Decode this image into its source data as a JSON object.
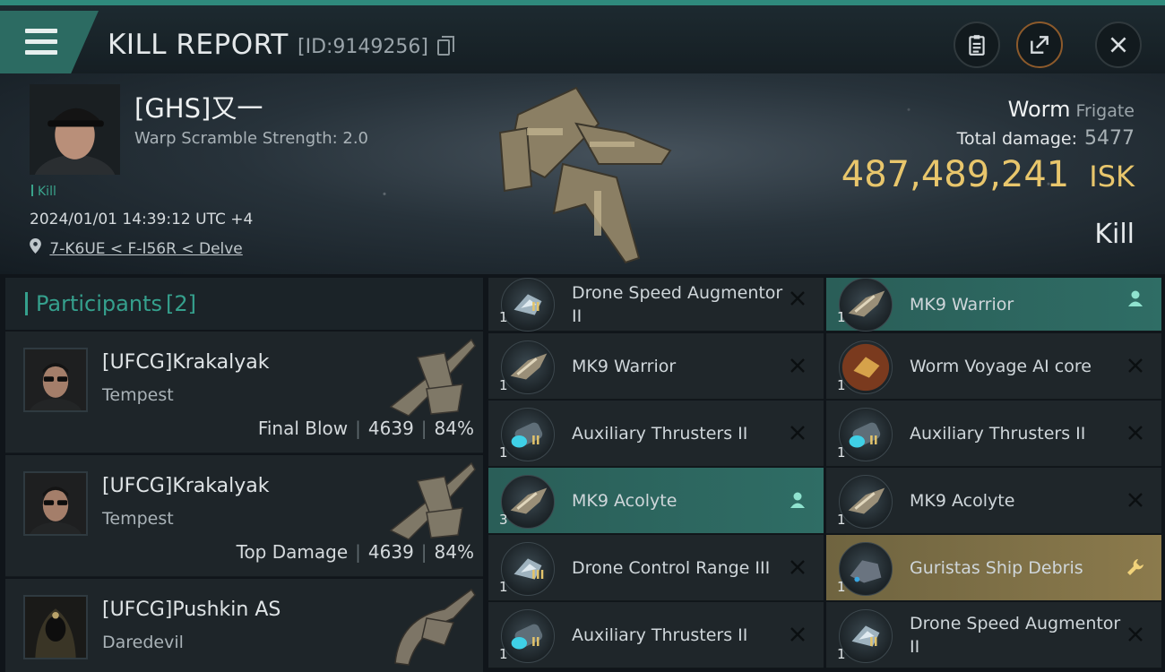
{
  "window": {
    "title": "KILL REPORT",
    "id_text": "[ID:9149256]"
  },
  "victim": {
    "name": "[GHS]又一",
    "stat": "Warp Scramble Strength: 2.0",
    "tag": "Kill",
    "datetime": "2024/01/01 14:39:12 UTC +4",
    "location": "7-K6UE < F-I56R < Delve",
    "ship_name": "Worm",
    "ship_class": "Frigate",
    "total_damage_label": "Total damage:",
    "total_damage": "5477",
    "isk_value": "487,489,241",
    "isk_unit": "ISK",
    "result": "Kill"
  },
  "participants": {
    "label": "Participants",
    "count": "[2]",
    "items": [
      {
        "name": "[UFCG]Krakalyak",
        "ship": "Tempest",
        "role": "Final Blow",
        "damage": "4639",
        "percent": "84%"
      },
      {
        "name": "[UFCG]Krakalyak",
        "ship": "Tempest",
        "role": "Top Damage",
        "damage": "4639",
        "percent": "84%"
      },
      {
        "name": "[UFCG]Pushkin AS",
        "ship": "Daredevil",
        "role": "",
        "damage": "",
        "percent": ""
      }
    ]
  },
  "items_left": [
    {
      "qty": "1",
      "name": "Drone Speed Augmentor II",
      "meta": "II",
      "icon": "rig-icon",
      "state": "destroyed",
      "action": "close-icon"
    },
    {
      "qty": "1",
      "name": "MK9  Warrior",
      "meta": "",
      "icon": "drone-icon",
      "state": "destroyed",
      "action": "close-icon"
    },
    {
      "qty": "1",
      "name": "Auxiliary Thrusters II",
      "meta": "II",
      "icon": "thruster-icon",
      "state": "destroyed",
      "action": "close-icon"
    },
    {
      "qty": "3",
      "name": "MK9  Acolyte",
      "meta": "",
      "icon": "drone-icon",
      "state": "dropped",
      "action": "person-icon"
    },
    {
      "qty": "1",
      "name": "Drone Control Range III",
      "meta": "III",
      "icon": "rig-icon",
      "state": "destroyed",
      "action": "close-icon"
    },
    {
      "qty": "1",
      "name": "Auxiliary Thrusters II",
      "meta": "II",
      "icon": "thruster-icon",
      "state": "destroyed",
      "action": "close-icon"
    }
  ],
  "items_right": [
    {
      "qty": "1",
      "name": "MK9  Warrior",
      "meta": "",
      "icon": "drone-icon",
      "state": "dropped",
      "action": "person-icon"
    },
    {
      "qty": "1",
      "name": "Worm Voyage AI core",
      "meta": "",
      "icon": "ai-core-icon",
      "state": "destroyed",
      "action": "close-icon"
    },
    {
      "qty": "1",
      "name": "Auxiliary Thrusters II",
      "meta": "II",
      "icon": "thruster-icon",
      "state": "destroyed",
      "action": "close-icon"
    },
    {
      "qty": "1",
      "name": "MK9  Acolyte",
      "meta": "",
      "icon": "drone-icon",
      "state": "destroyed",
      "action": "close-icon"
    },
    {
      "qty": "1",
      "name": "Guristas Ship Debris",
      "meta": "",
      "icon": "debris-icon",
      "state": "salvage",
      "action": "wrench-icon"
    },
    {
      "qty": "1",
      "name": "Drone Speed Augmentor II",
      "meta": "II",
      "icon": "rig-icon",
      "state": "destroyed",
      "action": "close-icon"
    }
  ],
  "colors": {
    "accent": "#35a08d",
    "isk": "#e8c66c",
    "dropped_row": "#2f6d65",
    "salvage_row": "#8b7a4c"
  }
}
